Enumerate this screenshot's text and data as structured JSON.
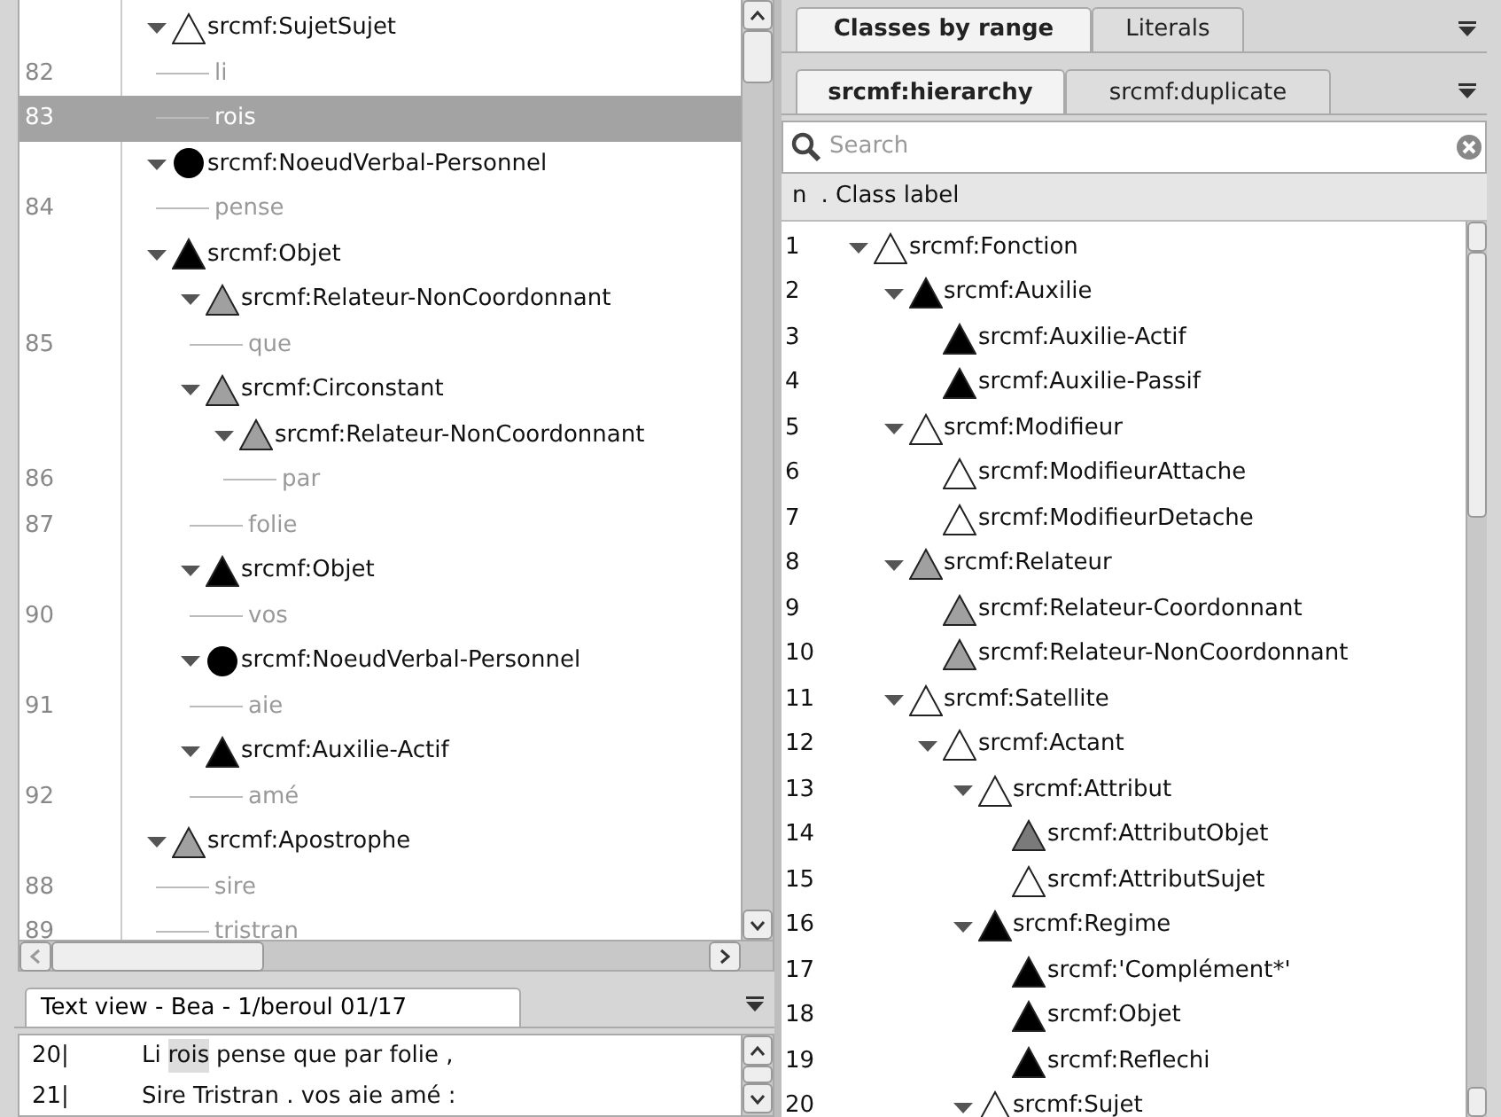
{
  "left_tree": {
    "items": [
      {
        "kind": "triangle",
        "label": "srcmf:SujetSujet",
        "filled": false,
        "expanded": true,
        "selected": false,
        "children": [
          {
            "kind": "token",
            "line": "82",
            "text": "li",
            "selected": false
          },
          {
            "kind": "token",
            "line": "83",
            "text": "rois",
            "selected": true
          }
        ]
      },
      {
        "kind": "circle",
        "label": "srcmf:NoeudVerbal-Personnel",
        "filled": true,
        "color": "#000000",
        "expanded": true,
        "selected": false,
        "children": [
          {
            "kind": "token",
            "line": "84",
            "text": "pense",
            "selected": false
          }
        ]
      },
      {
        "kind": "triangle",
        "label": "srcmf:Objet",
        "filled": true,
        "color": "#000000",
        "expanded": true,
        "selected": false,
        "children": [
          {
            "kind": "triangle",
            "label": "srcmf:Relateur-NonCoordonnant",
            "filled": true,
            "color": "#a0a0a0",
            "expanded": true,
            "selected": false,
            "children": [
              {
                "kind": "token",
                "line": "85",
                "text": "que",
                "selected": false
              }
            ]
          },
          {
            "kind": "triangle",
            "label": "srcmf:Circonstant",
            "filled": true,
            "color": "#a0a0a0",
            "expanded": true,
            "selected": false,
            "children": [
              {
                "kind": "triangle",
                "label": "srcmf:Relateur-NonCoordonnant",
                "filled": true,
                "color": "#a0a0a0",
                "expanded": true,
                "selected": false,
                "children": [
                  {
                    "kind": "token",
                    "line": "86",
                    "text": "par",
                    "selected": false
                  }
                ]
              },
              {
                "kind": "token",
                "line": "87",
                "text": "folie",
                "selected": false
              }
            ]
          },
          {
            "kind": "triangle",
            "label": "srcmf:Objet",
            "filled": true,
            "color": "#000000",
            "expanded": true,
            "selected": false,
            "children": [
              {
                "kind": "token",
                "line": "90",
                "text": "vos",
                "selected": false
              }
            ]
          },
          {
            "kind": "circle",
            "label": "srcmf:NoeudVerbal-Personnel",
            "filled": true,
            "color": "#000000",
            "expanded": true,
            "selected": false,
            "children": [
              {
                "kind": "token",
                "line": "91",
                "text": "aie",
                "selected": false
              }
            ]
          },
          {
            "kind": "triangle",
            "label": "srcmf:Auxilie-Actif",
            "filled": true,
            "color": "#000000",
            "expanded": true,
            "selected": false,
            "children": [
              {
                "kind": "token",
                "line": "92",
                "text": "amé",
                "selected": false
              }
            ]
          }
        ]
      },
      {
        "kind": "triangle",
        "label": "srcmf:Apostrophe",
        "filled": true,
        "color": "#a0a0a0",
        "expanded": true,
        "selected": false,
        "children": [
          {
            "kind": "token",
            "line": "88",
            "text": "sire",
            "selected": false
          },
          {
            "kind": "token",
            "line": "89",
            "text": "tristran",
            "selected": false
          }
        ]
      }
    ]
  },
  "text_view": {
    "tab": {
      "label": "Text view - Bea - 1/beroul 01/17",
      "selected": true
    },
    "lines": [
      {
        "number": "20|",
        "words": [
          {
            "text": "Li",
            "highlighted": false
          },
          {
            "text": "rois",
            "highlighted": true
          },
          {
            "text": "pense que par folie ,",
            "highlighted": false
          }
        ]
      },
      {
        "number": "21|",
        "words": [
          {
            "text": "Sire Tristran . vos aie amé :",
            "highlighted": false
          }
        ]
      }
    ]
  },
  "right_panel": {
    "tabs": [
      {
        "label": "Classes by range",
        "selected": true
      },
      {
        "label": "Literals",
        "selected": false
      }
    ],
    "subtabs": [
      {
        "label": "srcmf:hierarchy",
        "selected": true
      },
      {
        "label": "srcmf:duplicate",
        "selected": false
      }
    ],
    "search": {
      "placeholder": "Search"
    },
    "columns": [
      "n",
      ". Class label"
    ],
    "tree": [
      {
        "n": "1",
        "label": "srcmf:Fonction",
        "kind": "triangle",
        "filled": false,
        "expanded": true,
        "children": [
          {
            "n": "2",
            "label": "srcmf:Auxilie",
            "kind": "triangle",
            "filled": true,
            "color": "#000000",
            "expanded": true,
            "children": [
              {
                "n": "3",
                "label": "srcmf:Auxilie-Actif",
                "kind": "triangle",
                "filled": true,
                "color": "#000000"
              },
              {
                "n": "4",
                "label": "srcmf:Auxilie-Passif",
                "kind": "triangle",
                "filled": true,
                "color": "#000000"
              }
            ]
          },
          {
            "n": "5",
            "label": "srcmf:Modifieur",
            "kind": "triangle",
            "filled": false,
            "expanded": true,
            "children": [
              {
                "n": "6",
                "label": "srcmf:ModifieurAttache",
                "kind": "triangle",
                "filled": false
              },
              {
                "n": "7",
                "label": "srcmf:ModifieurDetache",
                "kind": "triangle",
                "filled": false
              }
            ]
          },
          {
            "n": "8",
            "label": "srcmf:Relateur",
            "kind": "triangle",
            "filled": true,
            "color": "#a0a0a0",
            "expanded": true,
            "children": [
              {
                "n": "9",
                "label": "srcmf:Relateur-Coordonnant",
                "kind": "triangle",
                "filled": true,
                "color": "#a0a0a0"
              },
              {
                "n": "10",
                "label": "srcmf:Relateur-NonCoordonnant",
                "kind": "triangle",
                "filled": true,
                "color": "#a0a0a0"
              }
            ]
          },
          {
            "n": "11",
            "label": "srcmf:Satellite",
            "kind": "triangle",
            "filled": false,
            "expanded": true,
            "children": [
              {
                "n": "12",
                "label": "srcmf:Actant",
                "kind": "triangle",
                "filled": false,
                "expanded": true,
                "children": [
                  {
                    "n": "13",
                    "label": "srcmf:Attribut",
                    "kind": "triangle",
                    "filled": false,
                    "expanded": true,
                    "children": [
                      {
                        "n": "14",
                        "label": "srcmf:AttributObjet",
                        "kind": "triangle",
                        "filled": true,
                        "color": "#7a7a7a"
                      },
                      {
                        "n": "15",
                        "label": "srcmf:AttributSujet",
                        "kind": "triangle",
                        "filled": false
                      }
                    ]
                  },
                  {
                    "n": "16",
                    "label": "srcmf:Regime",
                    "kind": "triangle",
                    "filled": true,
                    "color": "#000000",
                    "expanded": true,
                    "children": [
                      {
                        "n": "17",
                        "label": "srcmf:'Complément*'",
                        "kind": "triangle",
                        "filled": true,
                        "color": "#000000"
                      },
                      {
                        "n": "18",
                        "label": "srcmf:Objet",
                        "kind": "triangle",
                        "filled": true,
                        "color": "#000000"
                      },
                      {
                        "n": "19",
                        "label": "srcmf:Reflechi",
                        "kind": "triangle",
                        "filled": true,
                        "color": "#000000"
                      }
                    ]
                  },
                  {
                    "n": "20",
                    "label": "srcmf:Sujet",
                    "kind": "triangle",
                    "filled": false,
                    "expanded": true
                  }
                ]
              }
            ]
          }
        ]
      }
    ]
  }
}
